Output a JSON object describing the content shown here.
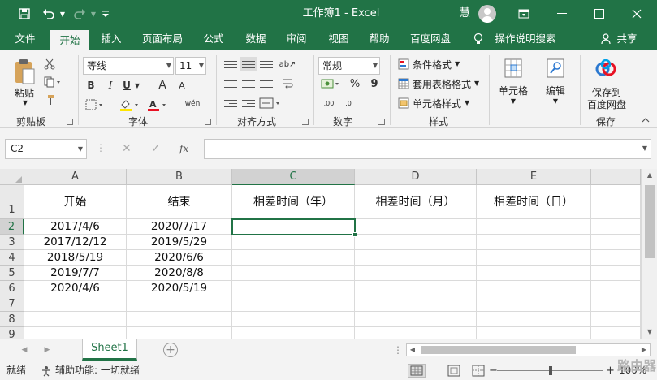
{
  "titlebar": {
    "title": "工作簿1  -  Excel",
    "user": "慧",
    "save_icon": "💾",
    "undo_icon": "↶",
    "redo_icon": "↷",
    "customize_icon": "⌄",
    "ribbon_display_icon": "▭",
    "minimize_icon": "—",
    "maximize_icon": "☐",
    "close_icon": "✕"
  },
  "tabs": [
    {
      "label": "文件"
    },
    {
      "label": "开始"
    },
    {
      "label": "插入"
    },
    {
      "label": "页面布局"
    },
    {
      "label": "公式"
    },
    {
      "label": "数据"
    },
    {
      "label": "审阅"
    },
    {
      "label": "视图"
    },
    {
      "label": "帮助"
    },
    {
      "label": "百度网盘"
    },
    {
      "label": "操作说明搜索"
    }
  ],
  "share_label": "共享",
  "ribbon": {
    "clipboard": {
      "label": "剪贴板",
      "paste": "粘贴"
    },
    "font": {
      "label": "字体",
      "name": "等线",
      "size": "11",
      "bold": "B",
      "italic": "I",
      "underline": "U",
      "grow": "A",
      "shrink": "A",
      "phonetic": "wén"
    },
    "alignment": {
      "label": "对齐方式"
    },
    "number": {
      "label": "数字",
      "format": "常规",
      "percent": "%",
      "comma": "9",
      "inc_dec": ".00",
      "dec_dec": ".0"
    },
    "styles": {
      "label": "样式",
      "conditional": "条件格式",
      "table": "套用表格格式",
      "cell": "单元格样式"
    },
    "cells": {
      "label": "单元格"
    },
    "editing": {
      "label": "编辑"
    },
    "save": {
      "label": "保存",
      "button": "保存到",
      "button2": "百度网盘"
    }
  },
  "formula_bar": {
    "name_box": "C2",
    "cancel": "✕",
    "enter": "✓",
    "fx": "fx",
    "formula": ""
  },
  "grid": {
    "columns": [
      "A",
      "B",
      "C",
      "D",
      "E"
    ],
    "rows": [
      "1",
      "2",
      "3",
      "4",
      "5",
      "6",
      "7",
      "8",
      "9"
    ],
    "cells": {
      "A1": "开始",
      "B1": "结束",
      "C1": "相差时间（年）",
      "D1": "相差时间（月）",
      "E1": "相差时间（日）",
      "A2": "2017/4/6",
      "B2": "2020/7/17",
      "A3": "2017/12/12",
      "B3": "2019/5/29",
      "A4": "2018/5/19",
      "B4": "2020/6/6",
      "A5": "2019/7/7",
      "B5": "2020/8/8",
      "A6": "2020/4/6",
      "B6": "2020/5/19"
    },
    "selected": "C2"
  },
  "sheets": [
    {
      "name": "Sheet1"
    }
  ],
  "status": {
    "ready": "就绪",
    "accessibility": "辅助功能: 一切就绪",
    "zoom": "100%",
    "watermark": "路由器"
  }
}
